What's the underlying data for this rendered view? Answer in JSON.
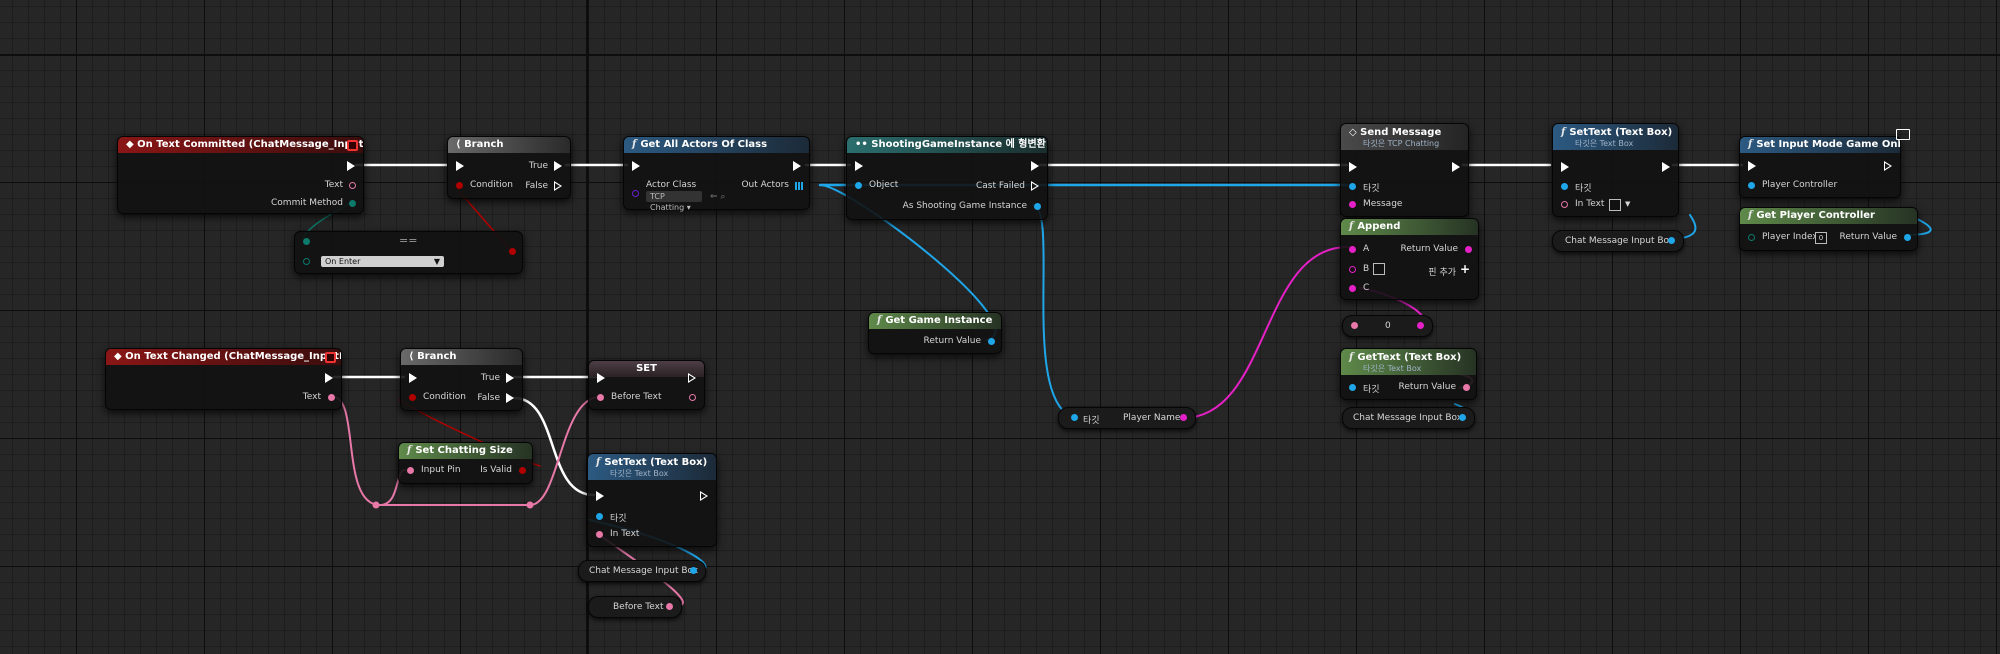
{
  "nodes": {
    "on_text_committed": {
      "title": "On Text Committed (ChatMessage_InputBox)",
      "text_pin": "Text",
      "commit_method_pin": "Commit Method"
    },
    "equal_node": {
      "title": "==",
      "value": "On Enter"
    },
    "branch1": {
      "title": "Branch",
      "condition": "Condition",
      "true_pin": "True",
      "false_pin": "False"
    },
    "get_all_actors": {
      "title": "Get All Actors Of Class",
      "actor_class": "Actor Class",
      "class_value": "TCP Chatting",
      "out_actors": "Out Actors"
    },
    "cast_node": {
      "title": "ShootingGameInstance 에 형변환",
      "object": "Object",
      "cast_failed": "Cast Failed",
      "as_instance": "As Shooting Game Instance"
    },
    "send_message": {
      "title": "Send Message",
      "subtitle": "타깃은 TCP Chatting",
      "target": "타깃",
      "message": "Message"
    },
    "settext_top": {
      "title": "SetText (Text Box)",
      "subtitle": "타깃은 Text Box",
      "target": "타깃",
      "in_text": "In Text"
    },
    "set_input_mode": {
      "title": "Set Input Mode Game Only",
      "player_controller": "Player Controller"
    },
    "get_player_controller": {
      "title": "Get Player Controller",
      "player_index": "Player Index",
      "index_value": "0",
      "return_value": "Return Value"
    },
    "append": {
      "title": "Append",
      "a": "A",
      "b": "B",
      "c": "C",
      "return_value": "Return Value",
      "add_pin": "핀 추가"
    },
    "literal_zero": {
      "value": "0"
    },
    "gettext": {
      "title": "GetText (Text Box)",
      "subtitle": "타깃은 Text Box",
      "target": "타깃",
      "return_value": "Return Value"
    },
    "var_chat_top": {
      "label": "Chat Message Input Box"
    },
    "var_chat_mid": {
      "label": "Chat Message Input Box"
    },
    "get_game_instance": {
      "title": "Get Game Instance",
      "return_value": "Return Value"
    },
    "player_name_node": {
      "target": "타깃",
      "label": "Player Name"
    },
    "on_text_changed": {
      "title": "On Text Changed (ChatMessage_InputBox)",
      "text_pin": "Text"
    },
    "branch2": {
      "title": "Branch",
      "condition": "Condition",
      "true_pin": "True",
      "false_pin": "False"
    },
    "set_node": {
      "title": "SET",
      "before_text": "Before Text"
    },
    "set_chatting_size": {
      "title": "Set Chatting Size",
      "input_pin": "Input Pin",
      "is_valid": "Is Valid"
    },
    "settext_bottom": {
      "title": "SetText (Text Box)",
      "subtitle": "타깃은 Text Box",
      "target": "타깃",
      "in_text": "In Text"
    },
    "var_chat_bottom": {
      "label": "Chat Message Input Box"
    },
    "var_before_text": {
      "label": "Before Text"
    }
  },
  "colors": {
    "exec": "#ffffff",
    "object": "#1fa6e8",
    "text": "#e778a8",
    "string": "#e520c6",
    "bool": "#b00000",
    "enum": "#0c7a6a",
    "class": "#6a1fd0"
  }
}
